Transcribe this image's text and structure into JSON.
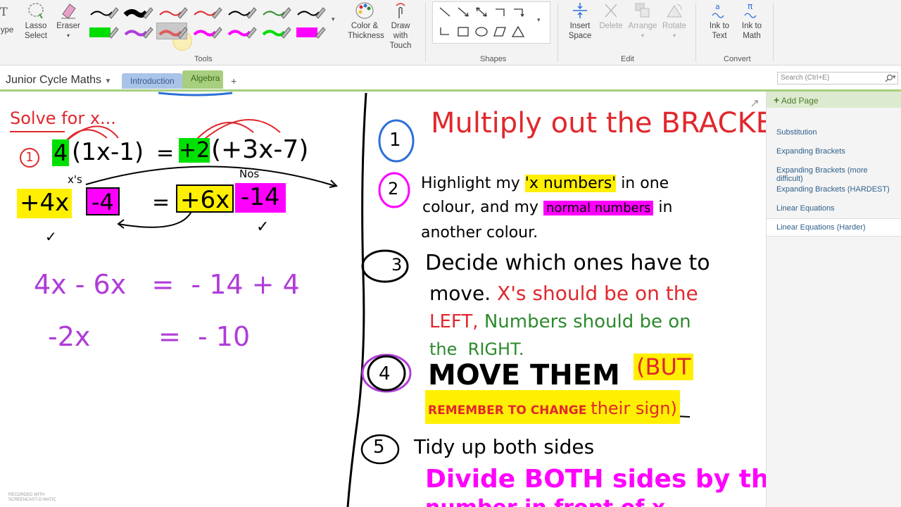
{
  "ribbon": {
    "type_label": "ype",
    "lasso": {
      "line1": "Lasso",
      "line2": "Select"
    },
    "eraser": {
      "label": "Eraser"
    },
    "color_thickness": {
      "line1": "Color &",
      "line2": "Thickness"
    },
    "draw_touch": {
      "line1": "Draw with",
      "line2": "Touch"
    },
    "insert_space": {
      "line1": "Insert",
      "line2": "Space"
    },
    "delete_label": "Delete",
    "arrange_label": "Arrange",
    "rotate_label": "Rotate",
    "ink_to_text": {
      "line1": "Ink to",
      "line2": "Text"
    },
    "ink_to_math": {
      "line1": "Ink to",
      "line2": "Math"
    },
    "groups": {
      "tools": "Tools",
      "shapes": "Shapes",
      "edit": "Edit",
      "convert": "Convert"
    }
  },
  "pens": {
    "row1": [
      "#000000",
      "#000000",
      "#e0282d",
      "#e0282d",
      "#000000",
      "#2d8a2d",
      "#000000"
    ],
    "row2": [
      "#00dd00",
      "#b03cd8",
      "#e05a5a",
      "#ff00ff",
      "#ff00ff",
      "#00dd00",
      "#ff00ff"
    ],
    "selected_row2_index": 2
  },
  "tabbar": {
    "notebook": "Junior Cycle Maths",
    "tabs": [
      "Introduction",
      "Algebra"
    ],
    "add_symbol": "+",
    "search_placeholder": "Search (Ctrl+E)"
  },
  "pages": {
    "add_page": "Add Page",
    "items": [
      "Substitution",
      "Expanding Brackets",
      "Expanding Brackets (more difficult)",
      "Expanding Brackets (HARDEST)",
      "Linear Equations",
      "Linear Equations (Harder)"
    ],
    "selected_index": 5
  },
  "notes": {
    "solve_heading": "Solve for x...",
    "step1_num": "1",
    "eq1_left_coef": "4",
    "eq1_left_bracket": "(1x-1)",
    "eq1_equals": "=",
    "eq1_right_coef": "+2",
    "eq1_right_bracket": "(+3x-7)",
    "xs_label": "x's",
    "nos_label": "Nos",
    "eq2_t1": "+4x",
    "eq2_t2": "-4",
    "eq2_equals": "=",
    "eq2_t3": "+6x",
    "eq2_t4": "-14",
    "tick1": "✓",
    "tick2": "✓",
    "eq3": "4x - 6x   =  - 14 + 4",
    "eq4": "-2x        =  - 10"
  },
  "steps": {
    "s1_num": "1",
    "s1_text": "Multiply out the BRACKETS",
    "s2_num": "2",
    "s2_a": "Highlight my ",
    "s2_b": "'x numbers'",
    "s2_c": " in one",
    "s2_d": "colour, and my ",
    "s2_e": "normal numbers",
    "s2_f": " in",
    "s2_g": "another colour.",
    "s3_num": "3",
    "s3_a": "Decide which ones have to",
    "s3_b": "move. ",
    "s3_c": "X's should be on the",
    "s3_d": "LEFT, ",
    "s3_e": "Numbers should be on",
    "s3_f": "the  RIGHT.",
    "s4_num": "4",
    "s4_a": "MOVE THEM",
    "s4_b": "(BUT",
    "s4_c": "REMEMBER TO CHANGE ",
    "s4_d": "their sign)",
    "s5_num": "5",
    "s5_a": "Tidy up both sides",
    "s5_b": "Divide BOTH sides by the",
    "s5_c": "number in front of x"
  },
  "watermark": {
    "line1": "RECORDED WITH",
    "line2": "SCREENCAST-O-MATIC"
  },
  "colors": {
    "ink_red": "#e0282d",
    "ink_purple": "#b03cd8",
    "ink_green": "#2d8a2d",
    "highlight_yellow": "#ffef00",
    "highlight_pink": "#ff00ff",
    "accent_green": "#a7cf7f"
  }
}
